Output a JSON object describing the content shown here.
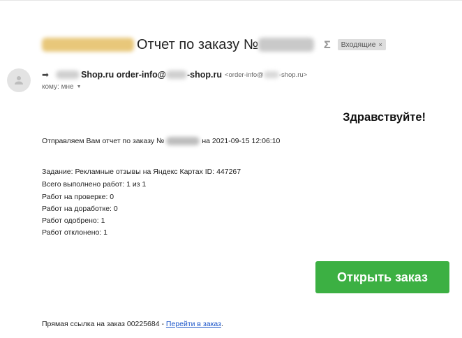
{
  "subject": {
    "text": "Отчет по заказу №",
    "label": "Входящие",
    "label_close": "×",
    "icon": "important-marker-icon"
  },
  "sender": {
    "name_suffix": "Shop.ru order-info@",
    "name_tail": "-shop.ru",
    "address_prefix": "<order-info@",
    "address_tail": "-shop.ru>",
    "to_text": "кому: мне",
    "to_caret": "▼"
  },
  "body": {
    "greeting": "Здравствуйте!",
    "report_prefix": "Отправляем Вам отчет по заказу №",
    "report_suffix": "на 2021-09-15 12:06:10",
    "details": [
      "Задание: Рекламные отзывы на Яндекс Картах ID: 447267",
      "Всего выполнено работ: 1 из 1",
      "Работ на проверке: 0",
      "Работ на доработке: 0",
      "Работ одобрено: 1",
      "Работ отклонено: 1"
    ],
    "button_label": "Открыть заказ"
  },
  "footer": {
    "text": "Прямая ссылка на заказ 00225684 - ",
    "link_text": "Перейти в заказ",
    "trailing": "."
  },
  "colors": {
    "button": "#3cb043",
    "link": "#1a55c9",
    "label_chip": "#dddddd"
  }
}
